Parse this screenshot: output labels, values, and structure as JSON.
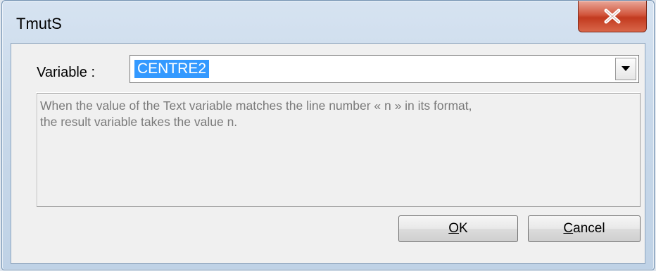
{
  "window": {
    "title": "TmutS"
  },
  "field": {
    "label": "Variable :",
    "value": "CENTRE2"
  },
  "description": {
    "line1": "When the value of the Text variable matches the line number « n » in its format,",
    "line2": "the result variable takes the value n."
  },
  "buttons": {
    "ok_mnemonic": "O",
    "ok_rest": "K",
    "cancel_mnemonic": "C",
    "cancel_rest": "ancel"
  },
  "colors": {
    "close_button": "#c9402a",
    "selection": "#3399ff",
    "window_frame": "#c9d9ea"
  },
  "icons": {
    "close": "close-x-icon",
    "dropdown": "chevron-down-icon"
  }
}
